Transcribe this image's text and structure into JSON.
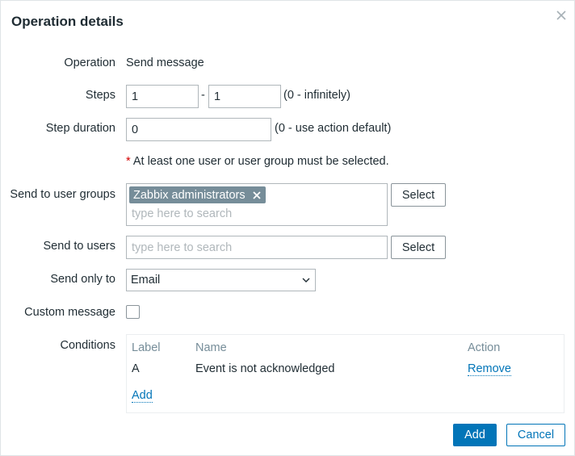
{
  "dialog": {
    "title": "Operation details",
    "close_icon": "close-icon"
  },
  "form": {
    "operation": {
      "label": "Operation",
      "value": "Send message"
    },
    "steps": {
      "label": "Steps",
      "from": "1",
      "separator": "-",
      "to": "1",
      "hint": "(0 - infinitely)"
    },
    "step_duration": {
      "label": "Step duration",
      "value": "0",
      "hint": "(0 - use action default)"
    },
    "required_note": {
      "star": "*",
      "text": "At least one user or user group must be selected."
    },
    "user_groups": {
      "label": "Send to user groups",
      "selected": [
        "Zabbix administrators"
      ],
      "placeholder": "type here to search",
      "select_label": "Select"
    },
    "users": {
      "label": "Send to users",
      "placeholder": "type here to search",
      "select_label": "Select"
    },
    "send_only_to": {
      "label": "Send only to",
      "value": "Email"
    },
    "custom_message": {
      "label": "Custom message",
      "checked": false
    },
    "conditions": {
      "label": "Conditions",
      "columns": [
        "Label",
        "Name",
        "Action"
      ],
      "rows": [
        {
          "label": "A",
          "name": "Event is not acknowledged",
          "action": "Remove"
        }
      ],
      "add_label": "Add"
    }
  },
  "footer": {
    "add_label": "Add",
    "cancel_label": "Cancel"
  },
  "colors": {
    "primary": "#0275b8",
    "chip": "#768d99",
    "required": "#d40000"
  }
}
